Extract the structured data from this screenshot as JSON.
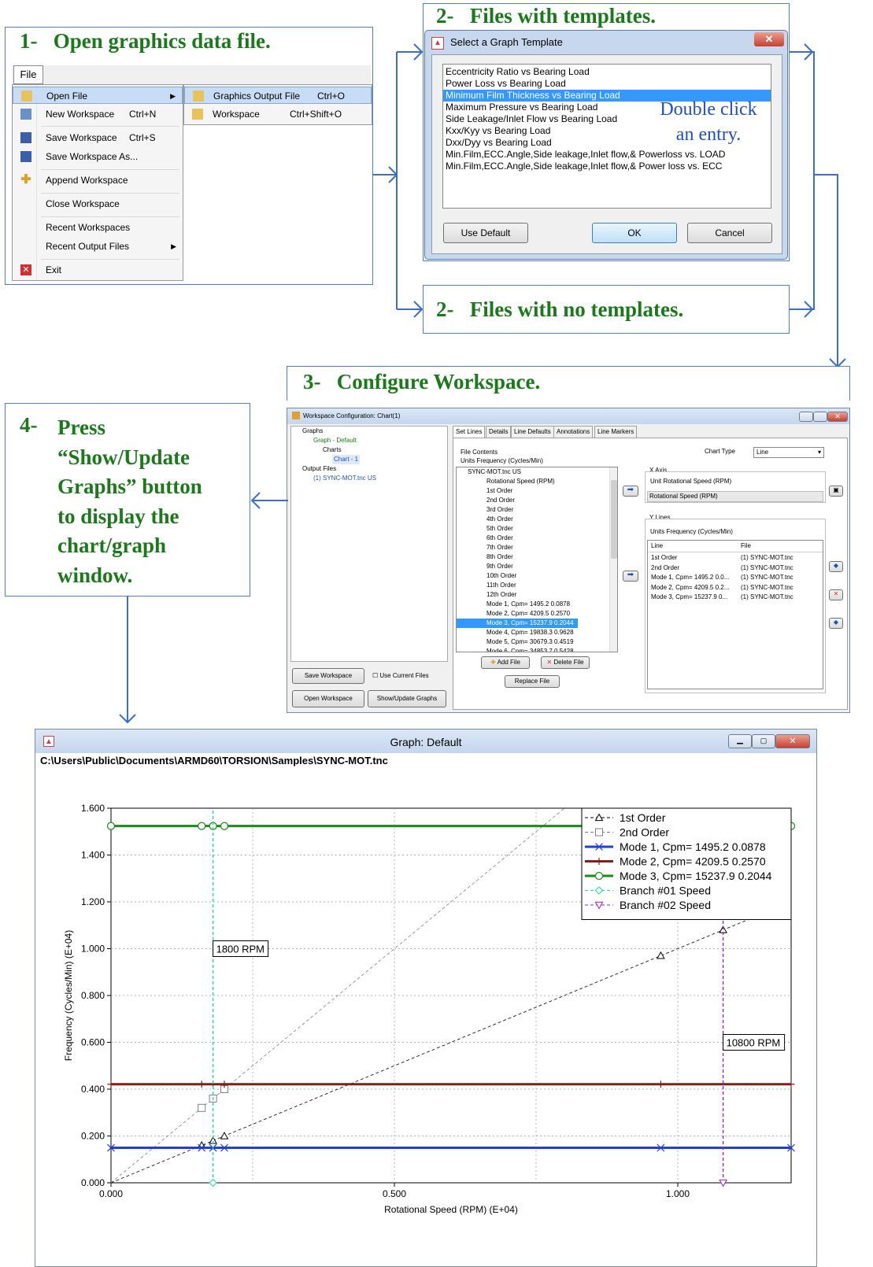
{
  "steps": {
    "s1": {
      "num": "1-",
      "text": "Open graphics data file."
    },
    "s2a": {
      "num": "2-",
      "text": "Files with templates."
    },
    "s2b": {
      "num": "2-",
      "text": "Files with no templates."
    },
    "s3": {
      "num": "3-",
      "text": "Configure Workspace."
    },
    "s4": {
      "num": "4-",
      "lines": [
        "Press",
        "“Show/Update",
        "Graphs” button",
        "to display the",
        "chart/graph",
        "window."
      ]
    }
  },
  "file_menu": {
    "title": "File",
    "items": [
      {
        "label": "Open File",
        "shortcut": "",
        "icon": "folder-open-icon",
        "submenu": true
      },
      {
        "label": "New Workspace",
        "shortcut": "Ctrl+N",
        "icon": "new-workspace-icon"
      },
      {
        "label": "Save Workspace",
        "shortcut": "Ctrl+S",
        "icon": "save-icon"
      },
      {
        "label": "Save Workspace As...",
        "shortcut": "",
        "icon": "save-as-icon"
      },
      {
        "label": "Append Workspace",
        "shortcut": "",
        "icon": "plus-icon"
      },
      {
        "label": "Close Workspace",
        "shortcut": "",
        "icon": ""
      },
      {
        "label": "Recent Workspaces",
        "shortcut": "",
        "icon": ""
      },
      {
        "label": "Recent Output Files",
        "shortcut": "",
        "icon": "",
        "submenu": true
      },
      {
        "label": "Exit",
        "shortcut": "",
        "icon": "exit-icon"
      }
    ],
    "submenu": [
      {
        "label": "Graphics Output File",
        "shortcut": "Ctrl+O"
      },
      {
        "label": "Workspace",
        "shortcut": "Ctrl+Shift+O"
      }
    ]
  },
  "template_dialog": {
    "title": "Select a Graph Template",
    "items": [
      "Eccentricity Ratio vs Bearing Load",
      "Power Loss vs Bearing Load",
      "Minimum Film Thickness vs Bearing Load",
      "Maximum Pressure vs Bearing Load",
      "Side Leakage/Inlet Flow vs Bearing Load",
      "Kxx/Kyy vs Bearing Load",
      "Dxx/Dyy vs Bearing Load",
      "Min.Film,ECC.Angle,Side leakage,Inlet flow,& Powerloss vs. LOAD",
      "Min.Film,ECC.Angle,Side leakage,Inlet flow,& Power loss vs. ECC"
    ],
    "selected_index": 2,
    "hint_line1": "Double click",
    "hint_line2": "an  entry.",
    "buttons": {
      "default": "Use Default",
      "ok": "OK",
      "cancel": "Cancel"
    }
  },
  "workspace": {
    "title": "Workspace Configuration: Chart(1)",
    "tree": [
      "Graphs",
      "Graph - Default",
      "Charts",
      "Chart - 1",
      "Output Files",
      "(1) SYNC-MOT.tnc US"
    ],
    "tabs": [
      "Set Lines",
      "Details",
      "Line Defaults",
      "Annotations",
      "Line Markers"
    ],
    "chart_type_label": "Chart Type",
    "chart_type_value": "Line",
    "file_contents_label": "File Contents",
    "units_label": "Units  Frequency (Cycles/Min)",
    "file_list": [
      "SYNC-MOT.tnc US",
      "Rotational Speed (RPM)",
      "1st Order",
      "2nd Order",
      "3rd Order",
      "4th Order",
      "5th Order",
      "6th Order",
      "7th Order",
      "8th Order",
      "9th Order",
      "10th Order",
      "11th Order",
      "12th Order",
      "Mode 1, Cpm=   1495.2  0.0878",
      "Mode 2, Cpm=   4209.5  0.2570",
      "Mode 3, Cpm=  15237.9  0.2044",
      "Mode 4, Cpm=  19838.3  0.9628",
      "Mode 5, Cpm=  30679.3  0.4519",
      "Mode 6, Cpm=  34853.7  0.5428"
    ],
    "file_selected_index": 16,
    "xaxis": {
      "title": "X Axis",
      "unit": "Unit    Rotational Speed (RPM)",
      "value": "Rotational Speed (RPM)"
    },
    "ylines": {
      "title": "Y Lines",
      "units": "Units  Frequency (Cycles/Min)",
      "headers": [
        "Line",
        "File"
      ],
      "rows": [
        [
          "1st Order",
          "(1) SYNC-MOT.tnc"
        ],
        [
          "2nd Order",
          "(1) SYNC-MOT.tnc"
        ],
        [
          "Mode 1, Cpm=   1495.2  0.0...",
          "(1) SYNC-MOT.tnc"
        ],
        [
          "Mode 2, Cpm=   4209.5  0.2...",
          "(1) SYNC-MOT.tnc"
        ],
        [
          "Mode 3, Cpm=  15237.9  0...",
          "(1) SYNC-MOT.tnc"
        ]
      ]
    },
    "buttons": {
      "add_file": "Add File",
      "delete_file": "Delete File",
      "replace_file": "Replace File",
      "save_ws": "Save Workspace",
      "use_current": "Use Current Files",
      "open_ws": "Open Workspace",
      "show_update": "Show/Update Graphs"
    }
  },
  "graph_window": {
    "title": "Graph: Default",
    "path": "C:\\Users\\Public\\Documents\\ARMD60\\TORSION\\Samples\\SYNC-MOT.tnc"
  },
  "chart_data": {
    "type": "line",
    "xlabel": "Rotational Speed (RPM) (E+04)",
    "ylabel": "Frequency (Cycles/Min) (E+04)",
    "xlim": [
      0,
      1.2
    ],
    "ylim": [
      0,
      1.6
    ],
    "xticks": [
      "0.000",
      "0.500",
      "1.000"
    ],
    "yticks": [
      "0.000",
      "0.200",
      "0.400",
      "0.600",
      "0.800",
      "1.000",
      "1.200",
      "1.400",
      "1.600"
    ],
    "grid": true,
    "legend_position": "top-right",
    "series": [
      {
        "name": "1st Order",
        "color": "#000000",
        "dash": "dashed",
        "marker": "triangle",
        "x": [
          0,
          1.2
        ],
        "y": [
          0,
          1.2
        ],
        "marker_x": [
          0.16,
          0.18,
          0.2,
          0.97,
          1.08
        ]
      },
      {
        "name": "2nd Order",
        "color": "#808080",
        "dash": "dashed",
        "marker": "square",
        "x": [
          0,
          0.8
        ],
        "y": [
          0,
          1.6
        ],
        "marker_x": [
          0.16,
          0.18,
          0.2
        ]
      },
      {
        "name": "Mode 1, Cpm=   1495.2   0.0878",
        "color": "#1f3fe0",
        "dash": "solid",
        "marker": "x",
        "x": [
          0,
          1.2
        ],
        "y": [
          0.1495,
          0.1495
        ]
      },
      {
        "name": "Mode 2, Cpm=   4209.5   0.2570",
        "color": "#8b1a1a",
        "dash": "solid",
        "marker": "plus",
        "x": [
          0,
          1.2
        ],
        "y": [
          0.421,
          0.421
        ]
      },
      {
        "name": "Mode 3, Cpm=  15237.9   0.2044",
        "color": "#1a8a1a",
        "dash": "solid",
        "marker": "circle",
        "x": [
          0,
          1.2
        ],
        "y": [
          1.524,
          1.524
        ]
      },
      {
        "name": "Branch #01 Speed",
        "color": "#20d8a0",
        "dash": "dashed",
        "marker": "diamond",
        "x": [
          0.18,
          0.18
        ],
        "y": [
          0,
          1.6
        ]
      },
      {
        "name": "Branch #02 Speed",
        "color": "#a020d0",
        "dash": "dashed",
        "marker": "triangle-down",
        "x": [
          1.08,
          1.08
        ],
        "y": [
          0,
          1.6
        ]
      }
    ],
    "annotations": [
      {
        "text": "1800 RPM",
        "x": 0.18,
        "y": 1.0
      },
      {
        "text": "10800 RPM",
        "x": 1.08,
        "y": 0.6
      }
    ]
  }
}
